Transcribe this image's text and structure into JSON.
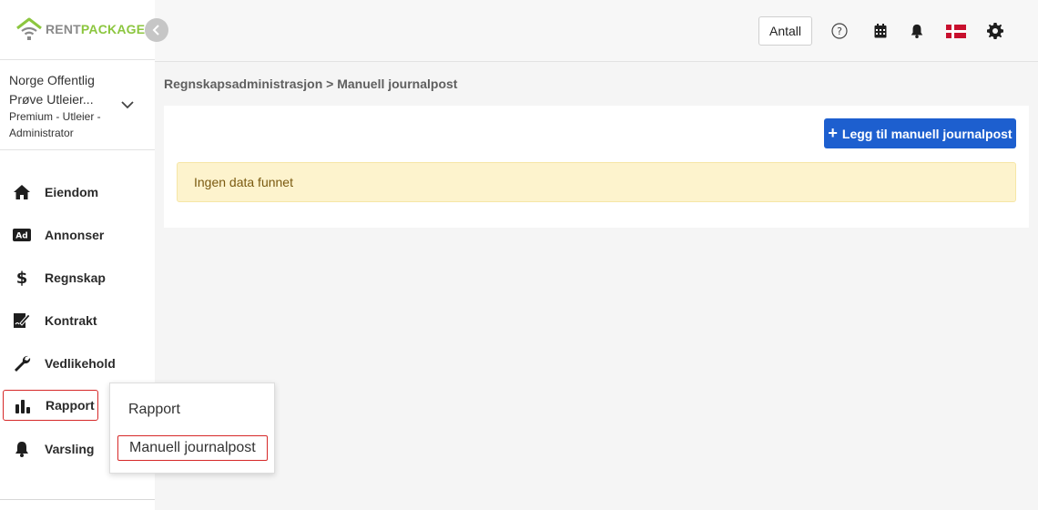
{
  "logo": {
    "rent": "RENT",
    "package": "PACKAGE"
  },
  "account": {
    "name": "Norge Offentlig Prøve Utleier...",
    "role": "Premium - Utleier - Administrator"
  },
  "sidebar": {
    "items": [
      {
        "label": "Eiendom",
        "icon": "home-icon"
      },
      {
        "label": "Annonser",
        "icon": "ad-icon"
      },
      {
        "label": "Regnskap",
        "icon": "dollar-icon"
      },
      {
        "label": "Kontrakt",
        "icon": "contract-icon"
      },
      {
        "label": "Vedlikehold",
        "icon": "wrench-icon"
      },
      {
        "label": "Rapport",
        "icon": "bar-chart-icon",
        "active": true
      },
      {
        "label": "Varsling",
        "icon": "bell-icon"
      }
    ]
  },
  "header": {
    "antall_label": "Antall",
    "icons": [
      "help-icon",
      "calendar-icon",
      "bell-icon",
      "flag-icon",
      "gear-icon"
    ]
  },
  "breadcrumb": "Regnskapsadministrasjon > Manuell journalpost",
  "main": {
    "add_button_label": "Legg til manuell journalpost",
    "empty_message": "Ingen data funnet"
  },
  "dropdown": {
    "items": [
      {
        "label": "Rapport"
      },
      {
        "label": "Manuell journalpost",
        "active": true
      }
    ]
  },
  "colors": {
    "accent": "#1d5fcf",
    "brand_green": "#8cc63f",
    "highlight_red": "#d62828",
    "alert_bg": "#fdf3cd"
  }
}
